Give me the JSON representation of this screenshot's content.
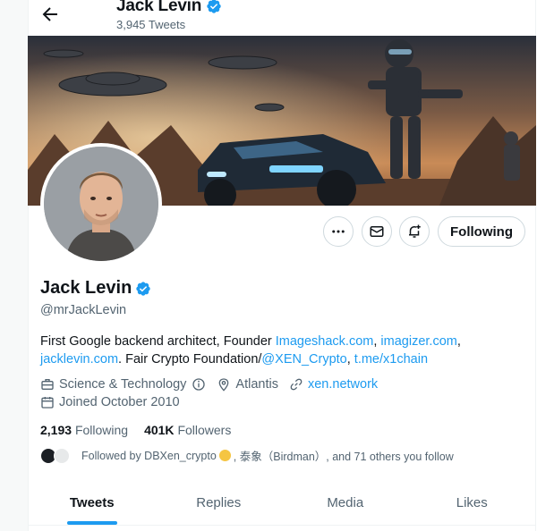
{
  "header": {
    "name": "Jack Levin",
    "tweet_count": "3,945 Tweets"
  },
  "profile": {
    "name": "Jack Levin",
    "handle": "@mrJackLevin",
    "bio": {
      "line1_prefix": "First Google backend architect, Founder ",
      "link_imageshack": "Imageshack.com",
      "comma1": ", ",
      "link_imagizer": "imagizer.com",
      "comma2": ",",
      "link_jacklevin": "jacklevin.com",
      "mid": ". Fair Crypto Foundation/",
      "link_xen": "@XEN_Crypto",
      "comma3": ", ",
      "link_tme": "t.me/x1chain"
    },
    "category": "Science & Technology",
    "location": "Atlantis",
    "website": "xen.network",
    "joined": "Joined October 2010",
    "following_count": "2,193",
    "following_label": "Following",
    "followers_count": "401K",
    "followers_label": "Followers",
    "followed_by_prefix": "Followed by DBXen_crypto",
    "followed_by_suffix": ", 泰象（Birdman）, and 71 others you follow"
  },
  "actions": {
    "more_icon": "more-dots-icon",
    "message_icon": "mail-icon",
    "notify_icon": "bell-plus-icon",
    "follow_label": "Following"
  },
  "tabs": [
    {
      "label": "Tweets",
      "active": true
    },
    {
      "label": "Replies",
      "active": false
    },
    {
      "label": "Media",
      "active": false
    },
    {
      "label": "Likes",
      "active": false
    }
  ],
  "colors": {
    "accent": "#1d9bf0",
    "text": "#0f1419",
    "secondary": "#536471"
  }
}
